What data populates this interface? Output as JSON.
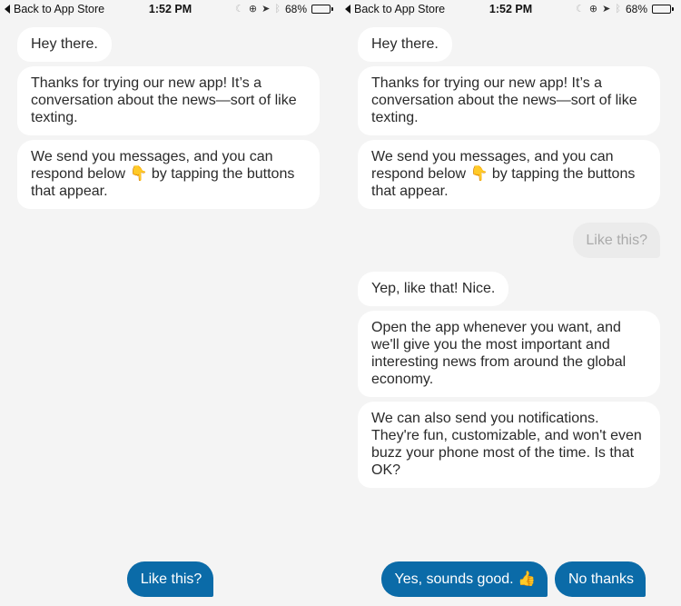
{
  "status_bar": {
    "back_label": "Back to App Store",
    "time": "1:52 PM",
    "battery_percent": "68%",
    "battery_level": 0.68,
    "icons": [
      "moon-icon",
      "rotation-lock-icon",
      "location-arrow-icon",
      "bluetooth-icon",
      "battery-icon"
    ]
  },
  "left_screen": {
    "messages": [
      {
        "text": "Hey there."
      },
      {
        "text": "Thanks for trying our new app! It’s a conversation about the news—sort of like texting."
      },
      {
        "text": "We send you messages, and you can respond below 👇 by tapping the buttons that appear."
      }
    ],
    "actions": [
      {
        "label": "Like this?"
      }
    ]
  },
  "right_screen": {
    "messages": [
      {
        "text": "Hey there."
      },
      {
        "text": "Thanks for trying our new app! It’s a conversation about the news—sort of like texting."
      },
      {
        "text": "We send you messages, and you can respond below 👇 by tapping the buttons that appear."
      }
    ],
    "user_reply": "Like this?",
    "messages_after": [
      {
        "text": "Yep, like that! Nice."
      },
      {
        "text": "Open the app whenever you want, and we'll give you the most important and interesting news from around the global economy."
      },
      {
        "text": "We can also send you notifications. They're fun, customizable, and won't even buzz your phone most of the time. Is that OK?"
      }
    ],
    "actions": [
      {
        "label": "Yes, sounds good. 👍"
      },
      {
        "label": "No thanks"
      }
    ]
  },
  "colors": {
    "button_blue": "#0b6ba8",
    "background": "#f4f4f4",
    "bot_bubble": "#ffffff",
    "user_bubble": "#ebebeb"
  }
}
